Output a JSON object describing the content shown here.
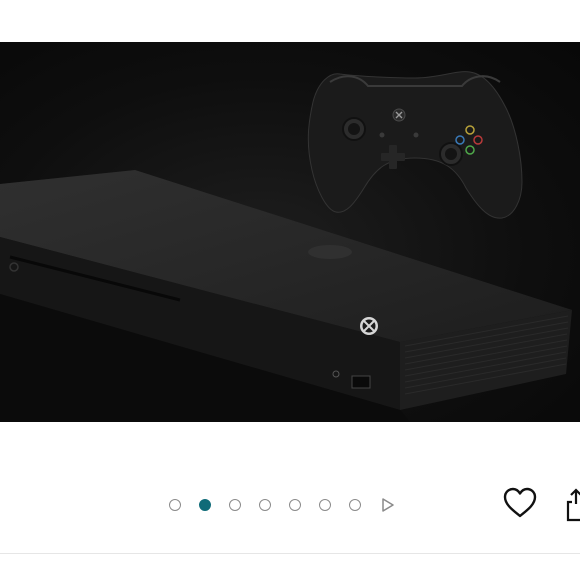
{
  "product_image": {
    "alt": "",
    "colors": {
      "background": "#0d0d0d",
      "console": "#1c1c1c",
      "controller": "#1a1a1a"
    }
  },
  "carousel": {
    "slide_count": 7,
    "active_index": 1,
    "active_color": "#0f6b78",
    "inactive_color": "#8a8a8a",
    "next_icon": "play-triangle-icon"
  },
  "actions": {
    "wishlist_icon": "heart-outline-icon",
    "share_icon": "share-icon"
  }
}
